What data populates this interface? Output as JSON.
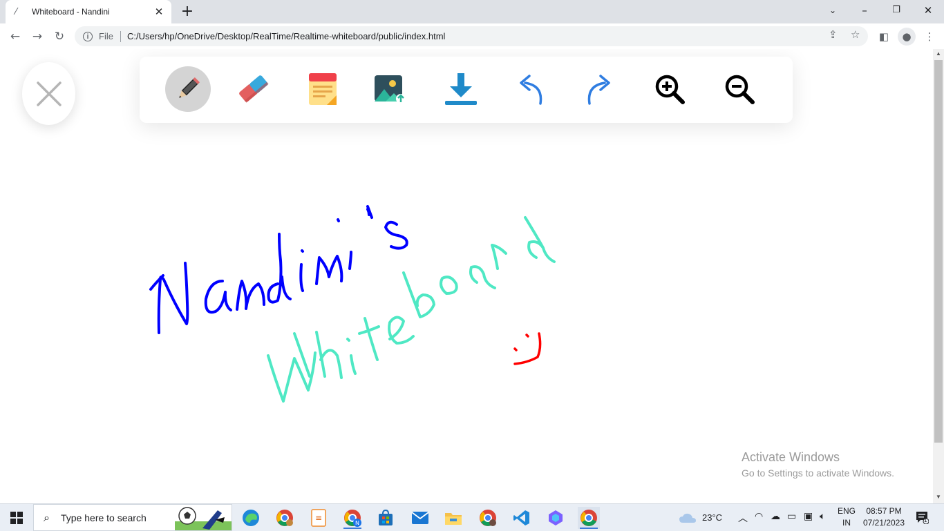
{
  "browser": {
    "tab_title": "Whiteboard - Nandini",
    "tab_icon": "slash-page-icon",
    "new_tab_label": "+",
    "omnibox": {
      "scheme_label": "File",
      "url": "C:/Users/hp/OneDrive/Desktop/RealTime/Realtime-whiteboard/public/index.html"
    }
  },
  "toolbar": {
    "tools": [
      {
        "name": "pencil",
        "icon": "pencil-icon",
        "active": true
      },
      {
        "name": "eraser",
        "icon": "eraser-icon",
        "active": false
      },
      {
        "name": "sticky-note",
        "icon": "sticky-note-icon",
        "active": false
      },
      {
        "name": "upload-image",
        "icon": "image-upload-icon",
        "active": false
      },
      {
        "name": "download",
        "icon": "download-icon",
        "active": false
      },
      {
        "name": "undo",
        "icon": "undo-icon",
        "active": false
      },
      {
        "name": "redo",
        "icon": "redo-icon",
        "active": false
      },
      {
        "name": "zoom-in",
        "icon": "zoom-in-icon",
        "active": false
      },
      {
        "name": "zoom-out",
        "icon": "zoom-out-icon",
        "active": false
      }
    ]
  },
  "canvas": {
    "drawings": [
      {
        "text": "Nandini's",
        "color": "#0000ff"
      },
      {
        "text": "Whiteboard",
        "color": "#4fe8c4"
      },
      {
        "text": "smiley",
        "color": "#ff0000"
      }
    ]
  },
  "watermark": {
    "title": "Activate Windows",
    "subtitle": "Go to Settings to activate Windows."
  },
  "taskbar": {
    "search_placeholder": "Type here to search",
    "apps": [
      "edge-icon",
      "chrome-profile-icon",
      "calculator-app-icon",
      "chrome-n-profile-icon",
      "store-icon",
      "mail-icon",
      "file-explorer-icon",
      "chrome-profile-2-icon",
      "vscode-icon",
      "copilot-icon",
      "chrome-icon"
    ],
    "weather": "23°C",
    "language": {
      "line1": "ENG",
      "line2": "IN"
    },
    "time": "08:57 PM",
    "date": "07/21/2023",
    "notification_count": "1"
  },
  "colors": {
    "accent": "#1a73e8",
    "ink_blue": "#0000ff",
    "ink_teal": "#4fe8c4",
    "ink_red": "#ff0000"
  }
}
